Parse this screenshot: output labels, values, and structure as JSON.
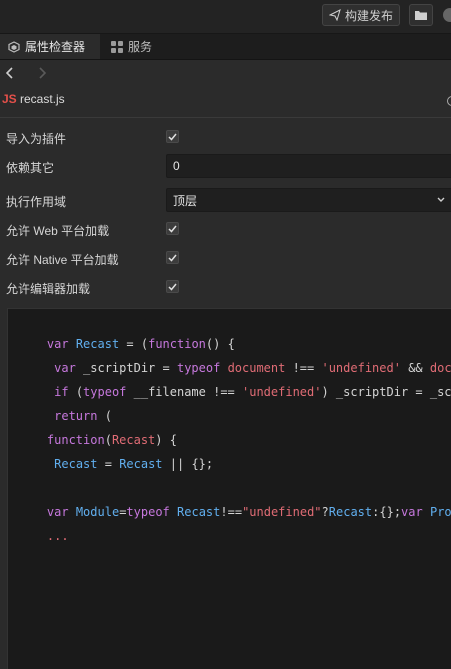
{
  "toolbar": {
    "build_label": "构建发布"
  },
  "tabs": [
    {
      "label": "属性检查器",
      "active": true,
      "icon": "inspector-icon"
    },
    {
      "label": "服务",
      "active": false,
      "icon": "services-icon"
    }
  ],
  "file": {
    "badge": "JS",
    "name": "recast.js"
  },
  "properties": [
    {
      "label": "导入为插件",
      "type": "checkbox",
      "checked": true
    },
    {
      "label": "依赖其它",
      "type": "input",
      "value": "0"
    },
    {
      "label": "执行作用域",
      "type": "select",
      "value": "顶层"
    },
    {
      "label": "允许 Web 平台加载",
      "type": "checkbox",
      "checked": true
    },
    {
      "label": "允许 Native 平台加载",
      "type": "checkbox",
      "checked": true
    },
    {
      "label": "允许编辑器加载",
      "type": "checkbox",
      "checked": true
    }
  ],
  "code": {
    "l1": [
      "var",
      " ",
      "Recast",
      " = (",
      "function",
      "() {"
    ],
    "l2": [
      " var",
      " _scriptDir = ",
      "typeof",
      " ",
      "document",
      " !== ",
      "'undefined'",
      " && ",
      "documen"
    ],
    "l3": [
      " if",
      " (",
      "typeof",
      " __filename !== ",
      "'undefined'",
      ") _scriptDir = _script"
    ],
    "l4": [
      " return",
      " ("
    ],
    "l5": [
      "function",
      "(",
      "Recast",
      ") {"
    ],
    "l6": [
      " ",
      "Recast",
      " = ",
      "Recast",
      " || {};"
    ],
    "l7": [
      "var",
      " ",
      "Module",
      "=",
      "typeof",
      " ",
      "Recast",
      "!==",
      "\"undefined\"",
      "?",
      "Recast",
      ":{};",
      "var",
      " ",
      "Promise"
    ],
    "l8": [
      "..."
    ]
  },
  "colors": {
    "keyword": "#c678dd",
    "identifier": "#61afef",
    "string": "#e06c75",
    "js_badge": "#e4504a"
  }
}
